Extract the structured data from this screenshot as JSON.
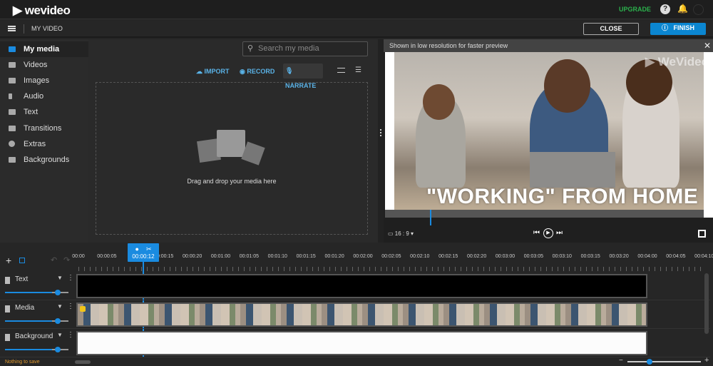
{
  "header": {
    "logo": "wevideo",
    "upgrade": "UPGRADE",
    "avatar": ""
  },
  "project": {
    "title": "MY VIDEO",
    "close": "CLOSE",
    "finish": "FINISH"
  },
  "sidebar": {
    "items": [
      {
        "label": "My media",
        "icon": "folder-icon",
        "selected": true
      },
      {
        "label": "Videos",
        "icon": "video-icon"
      },
      {
        "label": "Images",
        "icon": "image-icon"
      },
      {
        "label": "Audio",
        "icon": "music-note-icon"
      },
      {
        "label": "Text",
        "icon": "text-icon"
      },
      {
        "label": "Transitions",
        "icon": "transition-icon"
      },
      {
        "label": "Extras",
        "icon": "smiley-icon"
      },
      {
        "label": "Backgrounds",
        "icon": "backgrounds-icon"
      }
    ]
  },
  "media": {
    "search_placeholder": "Search my media",
    "import": "IMPORT",
    "record": "RECORD",
    "narrate": "NARRATE",
    "drop_text": "Drag and drop your media here"
  },
  "preview": {
    "notice": "Shown in low resolution for faster preview",
    "watermark": "WeVideo",
    "headline": "\"WORKING\" FROM HOME",
    "aspect": "16 : 9",
    "progress_percent": 14
  },
  "timeline": {
    "playhead": "00:00:12",
    "ruler": [
      "00:00",
      "00:00:05",
      "00:00:10",
      "00:00:15",
      "00:00:20",
      "00:01:00",
      "00:01:05",
      "00:01:10",
      "00:01:15",
      "00:01:20",
      "00:02:00",
      "00:02:05",
      "00:02:10",
      "00:02:15",
      "00:02:20",
      "00:03:00",
      "00:03:05",
      "00:03:10",
      "00:03:15",
      "00:03:20",
      "00:04:00",
      "00:04:05",
      "00:04:10"
    ],
    "tracks": [
      {
        "name": "Text",
        "volume": 0.75
      },
      {
        "name": "Media",
        "volume": 0.75
      },
      {
        "name": "Background",
        "volume": 0.75
      }
    ],
    "status": "Nothing to save",
    "zoom_level": 0.3
  },
  "colors": {
    "accent": "#1a8be0",
    "upgrade": "#2bb14c",
    "status": "#e39b2e"
  }
}
